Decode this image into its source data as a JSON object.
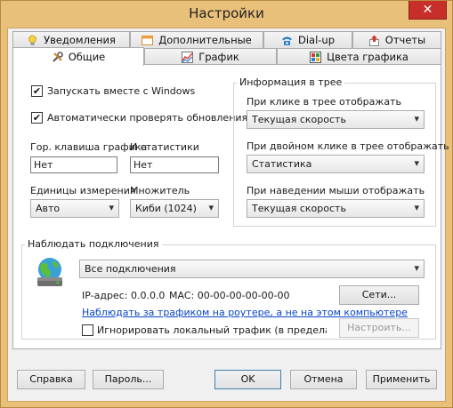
{
  "window": {
    "title": "Настройки",
    "close_glyph": "✕"
  },
  "tabs_row1": [
    {
      "label": "Уведомления",
      "icon": "lightbulb-icon"
    },
    {
      "label": "Дополнительные",
      "icon": "window-icon"
    },
    {
      "label": "Dial-up",
      "icon": "phone-icon"
    },
    {
      "label": "Отчеты",
      "icon": "export-icon"
    }
  ],
  "tabs_row2": [
    {
      "label": "Общие",
      "icon": "tools-icon",
      "active": true
    },
    {
      "label": "График",
      "icon": "chart-icon"
    },
    {
      "label": "Цвета графика",
      "icon": "grid-icon"
    }
  ],
  "general": {
    "run_with_windows": {
      "label": "Запускать вместе с Windows",
      "checked": true
    },
    "auto_update": {
      "label": "Автоматически проверять обновления",
      "checked": true
    },
    "hotkey_graph_label": "Гор. клавиша графика",
    "hotkey_graph_value": "Нет",
    "hotkey_stats_label": "И статистики",
    "hotkey_stats_value": "Нет",
    "units_label": "Единицы измерения",
    "units_value": "Авто",
    "multiplier_label": "Множитель",
    "multiplier_value": "Киби (1024)"
  },
  "tray": {
    "group_label": "Информация в трее",
    "click_label": "При клике в трее отображать",
    "click_value": "Текущая скорость",
    "dblclick_label": "При двойном клике в трее отображать",
    "dblclick_value": "Статистика",
    "hover_label": "При наведении мыши отображать",
    "hover_value": "Текущая скорость"
  },
  "connections": {
    "group_label": "Наблюдать подключения",
    "select_value": "Все подключения",
    "ip": "IP-адрес: 0.0.0.0",
    "mac": "MAC: 00-00-00-00-00-00",
    "networks_button": "Сети...",
    "router_link": "Наблюдать за трафиком на роутере, а не на этом компьютере",
    "ignore_local_label": "Игнорировать локальный трафик (в пределах сети",
    "ignore_local_checked": false,
    "configure_button": "Настроить..."
  },
  "footer": {
    "help": "Справка",
    "password": "Пароль...",
    "ok": "OK",
    "cancel": "Отмена",
    "apply": "Применить"
  },
  "glyphs": {
    "dropdown_arrow": "▾",
    "check": "✔"
  }
}
